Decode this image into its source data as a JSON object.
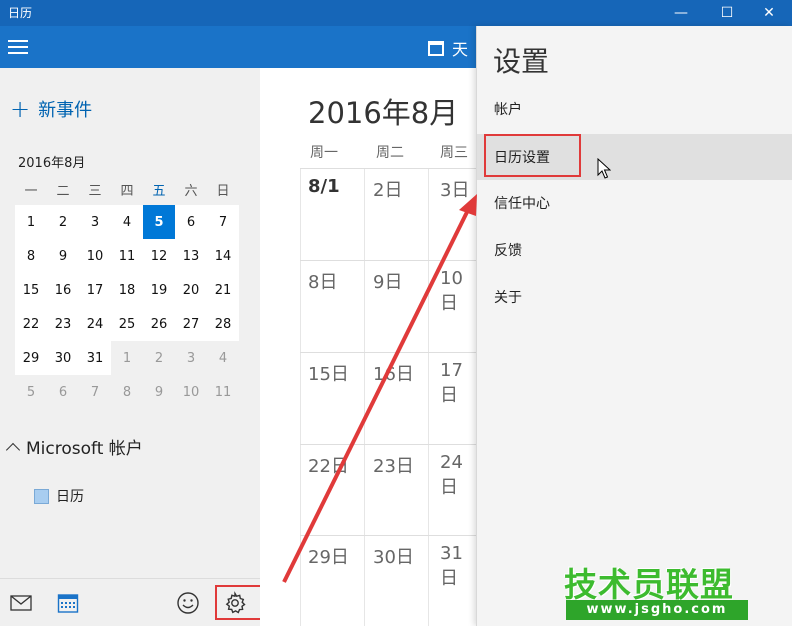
{
  "window": {
    "title": "日历",
    "min_glyph": "—",
    "max_glyph": "☐",
    "close_glyph": "✕"
  },
  "appbar": {
    "view_label": "天"
  },
  "sidebar": {
    "new_event": "新事件",
    "mini_calendar": {
      "title": "2016年8月",
      "weekdays": [
        "一",
        "二",
        "三",
        "四",
        "五",
        "六",
        "日"
      ],
      "today_weekday_index": 4,
      "weeks": [
        [
          "1",
          "2",
          "3",
          "4",
          "5",
          "6",
          "7"
        ],
        [
          "8",
          "9",
          "10",
          "11",
          "12",
          "13",
          "14"
        ],
        [
          "15",
          "16",
          "17",
          "18",
          "19",
          "20",
          "21"
        ],
        [
          "22",
          "23",
          "24",
          "25",
          "26",
          "27",
          "28"
        ],
        [
          "29",
          "30",
          "31",
          "1",
          "2",
          "3",
          "4"
        ],
        [
          "5",
          "6",
          "7",
          "8",
          "9",
          "10",
          "11"
        ]
      ],
      "today": "5"
    },
    "account_group": "Microsoft 帐户",
    "calendar_item": "日历"
  },
  "main": {
    "month_title": "2016年8月",
    "col_headers": [
      "周一",
      "周二",
      "周三"
    ],
    "rows": [
      [
        "8/1",
        "2日",
        "3日"
      ],
      [
        "8日",
        "9日",
        "10日"
      ],
      [
        "15日",
        "16日",
        "17日"
      ],
      [
        "22日",
        "23日",
        "24日"
      ],
      [
        "29日",
        "30日",
        "31日"
      ]
    ]
  },
  "settings": {
    "title": "设置",
    "items": [
      "帐户",
      "日历设置",
      "信任中心",
      "反馈",
      "关于"
    ],
    "hovered_item": "日历设置"
  },
  "watermark": {
    "brand": "技术员联盟",
    "url": "www.jsgho.com"
  },
  "colors": {
    "titlebar": "#1666b8",
    "appbar": "#1a73c8",
    "accent": "#0078d7",
    "highlight_red": "#e03a3a",
    "watermark_green": "#3dbb2f"
  }
}
